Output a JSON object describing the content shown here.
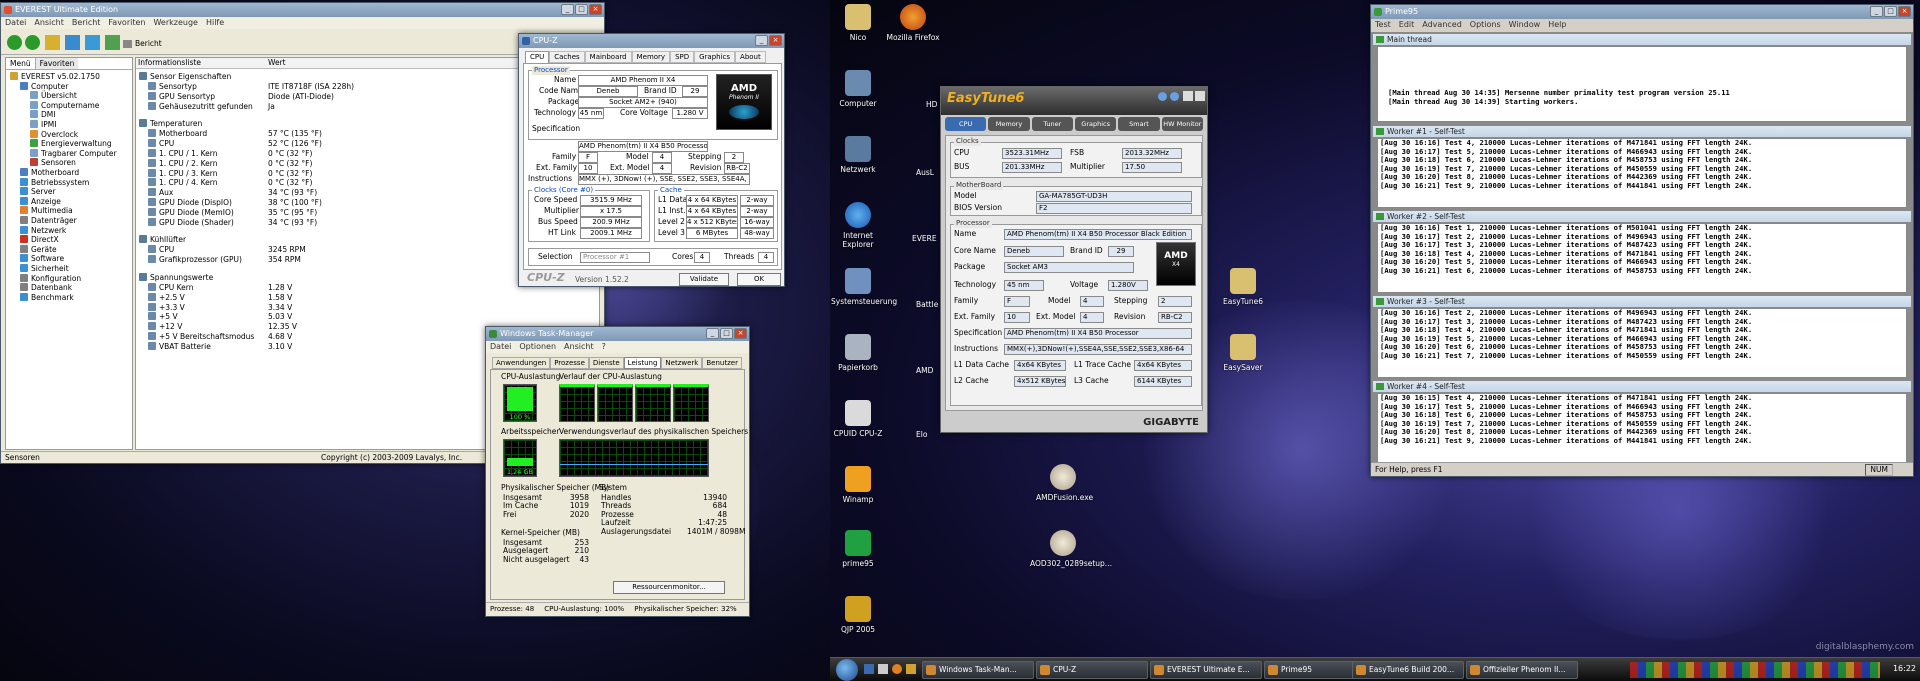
{
  "everest": {
    "title": "EVEREST Ultimate Edition",
    "menu": [
      "Datei",
      "Ansicht",
      "Bericht",
      "Favoriten",
      "Werkzeuge",
      "Hilfe"
    ],
    "report_button": "Bericht",
    "tabs": [
      "Menü",
      "Favoriten"
    ],
    "columns": {
      "info": "Informationsliste",
      "value": "Wert"
    },
    "tree": [
      "EVEREST v5.02.1750",
      "Computer",
      "Übersicht",
      "Computername",
      "DMI",
      "IPMI",
      "Overclock",
      "Energieverwaltung",
      "Tragbarer Computer",
      "Sensoren",
      "Motherboard",
      "Betriebssystem",
      "Server",
      "Anzeige",
      "Multimedia",
      "Datenträger",
      "Netzwerk",
      "DirectX",
      "Geräte",
      "Software",
      "Sicherheit",
      "Konfiguration",
      "Datenbank",
      "Benchmark"
    ],
    "sections": [
      {
        "title": "Sensor Eigenschaften",
        "rows": [
          [
            "Sensortyp",
            "ITE IT8718F (ISA 228h)"
          ],
          [
            "GPU Sensortyp",
            "Diode (ATI-Diode)"
          ],
          [
            "Gehäusezutritt gefunden",
            "Ja"
          ]
        ]
      },
      {
        "title": "Temperaturen",
        "rows": [
          [
            "Motherboard",
            "57 °C (135 °F)"
          ],
          [
            "CPU",
            "52 °C (126 °F)"
          ],
          [
            "1. CPU / 1. Kern",
            "0 °C (32 °F)"
          ],
          [
            "1. CPU / 2. Kern",
            "0 °C (32 °F)"
          ],
          [
            "1. CPU / 3. Kern",
            "0 °C (32 °F)"
          ],
          [
            "1. CPU / 4. Kern",
            "0 °C (32 °F)"
          ],
          [
            "Aux",
            "34 °C (93 °F)"
          ],
          [
            "GPU Diode (DispIO)",
            "38 °C (100 °F)"
          ],
          [
            "GPU Diode (MemIO)",
            "35 °C (95 °F)"
          ],
          [
            "GPU Diode (Shader)",
            "34 °C (93 °F)"
          ]
        ]
      },
      {
        "title": "Kühllüfter",
        "rows": [
          [
            "CPU",
            "3245 RPM"
          ],
          [
            "Grafikprozessor (GPU)",
            "354 RPM"
          ]
        ]
      },
      {
        "title": "Spannungswerte",
        "rows": [
          [
            "CPU Kern",
            "1.28 V"
          ],
          [
            "+2.5 V",
            "1.58 V"
          ],
          [
            "+3.3 V",
            "3.34 V"
          ],
          [
            "+5 V",
            "5.03 V"
          ],
          [
            "+12 V",
            "12.35 V"
          ],
          [
            "+5 V Bereitschaftsmodus",
            "4.68 V"
          ],
          [
            "VBAT Batterie",
            "3.10 V"
          ]
        ]
      }
    ],
    "status_left": "Sensoren",
    "status_right": "Copyright (c) 2003-2009 Lavalys, Inc."
  },
  "cpuz": {
    "title": "CPU-Z",
    "tabs": [
      "CPU",
      "Caches",
      "Mainboard",
      "Memory",
      "SPD",
      "Graphics",
      "About"
    ],
    "processor_label": "Processor",
    "name_label": "Name",
    "name": "AMD Phenom II X4",
    "codename_label": "Code Name",
    "codename": "Deneb",
    "brandid_label": "Brand ID",
    "brandid": "29",
    "package_label": "Package",
    "package": "Socket AM2+ (940)",
    "tech_label": "Technology",
    "tech": "45 nm",
    "cv_label": "Core Voltage",
    "cv": "1.280 V",
    "spec_label": "Specification",
    "spec": "AMD Phenom(tm) II X4 B50 Processor",
    "family_label": "Family",
    "family": "F",
    "model_label": "Model",
    "model": "4",
    "stepping_label": "Stepping",
    "stepping": "2",
    "extfam_label": "Ext. Family",
    "extfam": "10",
    "extmodel_label": "Ext. Model",
    "extmodel": "4",
    "revision_label": "Revision",
    "revision": "RB-C2",
    "instr_label": "Instructions",
    "instr": "MMX (+), 3DNow! (+), SSE, SSE2, SSE3, SSE4A, x86-64",
    "clocks_label": "Clocks (Core #0)",
    "corespeed_label": "Core Speed",
    "corespeed": "3515.9 MHz",
    "mult_label": "Multiplier",
    "mult": "x 17.5",
    "bus_label": "Bus Speed",
    "bus": "200.9 MHz",
    "ht_label": "HT Link",
    "ht": "2009.1 MHz",
    "cache_label": "Cache",
    "l1d_label": "L1 Data",
    "l1d": "4 x 64 KBytes",
    "l1d_w": "2-way",
    "l1i_label": "L1 Inst.",
    "l1i": "4 x 64 KBytes",
    "l1i_w": "2-way",
    "l2_label": "Level 2",
    "l2": "4 x 512 KBytes",
    "l2_w": "16-way",
    "l3_label": "Level 3",
    "l3": "6 MBytes",
    "l3_w": "48-way",
    "selection_label": "Selection",
    "selection": "Processor #1",
    "cores_label": "Cores",
    "cores": "4",
    "threads_label": "Threads",
    "threads": "4",
    "brand": "CPU-Z",
    "version": "Version 1.52.2",
    "validate": "Validate",
    "ok": "OK",
    "logo_top": "AMD",
    "logo_sub": "Phenom II"
  },
  "taskmgr": {
    "title": "Windows Task-Manager",
    "menu": [
      "Datei",
      "Optionen",
      "Ansicht",
      "?"
    ],
    "tabs": [
      "Anwendungen",
      "Prozesse",
      "Dienste",
      "Leistung",
      "Netzwerk",
      "Benutzer"
    ],
    "cpu_label": "CPU-Auslastung",
    "cpu_value": "100 %",
    "cpu_hist_label": "Verlauf der CPU-Auslastung",
    "mem_label": "Arbeitsspeicher",
    "mem_value": "1,24 GB",
    "mem_hist_label": "Verwendungsverlauf des physikalischen Speichers",
    "phys_title": "Physikalischer Speicher (MB)",
    "phys": [
      [
        "Insgesamt",
        "3958"
      ],
      [
        "Im Cache",
        "1019"
      ],
      [
        "Frei",
        "2020"
      ]
    ],
    "sys_title": "System",
    "sys": [
      [
        "Handles",
        "13940"
      ],
      [
        "Threads",
        "684"
      ],
      [
        "Prozesse",
        "48"
      ],
      [
        "Laufzeit",
        "1:47:25"
      ],
      [
        "Auslagerungsdatei",
        "1401M / 8098M"
      ]
    ],
    "kern_title": "Kernel-Speicher (MB)",
    "kern": [
      [
        "Insgesamt",
        "253"
      ],
      [
        "Ausgelagert",
        "210"
      ],
      [
        "Nicht ausgelagert",
        "43"
      ]
    ],
    "resmon": "Ressourcenmonitor...",
    "status": [
      "Prozesse: 48",
      "CPU-Auslastung: 100%",
      "Physikalischer Speicher: 32%"
    ],
    "cpu_load": 1.0,
    "mem_load": 0.32
  },
  "easytune": {
    "title": "EasyTune6",
    "tabs": [
      "CPU",
      "Memory",
      "Tuner",
      "Graphics",
      "Smart",
      "HW Monitor"
    ],
    "clocks_label": "Clocks",
    "cpu_label": "CPU",
    "cpu": "3523.31MHz",
    "fsb_label": "FSB",
    "fsb": "2013.32MHz",
    "bus_label": "BUS",
    "bus": "201.33MHz",
    "mult_label": "Multiplier",
    "mult": "17.50",
    "mb_label": "MotherBoard",
    "model_label": "Model",
    "model": "GA-MA785GT-UD3H",
    "bios_label": "BIOS Version",
    "bios": "F2",
    "proc_label": "Processor",
    "name_label": "Name",
    "name": "AMD Phenom(tm) II X4 B50 Processor Black Edition",
    "cn_label": "Core Name",
    "cn": "Deneb",
    "bid_label": "Brand ID",
    "bid": "29",
    "pkg_label": "Package",
    "pkg": "Socket AM3",
    "tech_label": "Technology",
    "tech": "45 nm",
    "volt_label": "Voltage",
    "volt": "1.280V",
    "fam_label": "Family",
    "fam": "F",
    "mod_label": "Model",
    "mod": "4",
    "step_label": "Stepping",
    "step": "2",
    "ef_label": "Ext. Family",
    "ef": "10",
    "em_label": "Ext. Model",
    "em": "4",
    "rev_label": "Revision",
    "rev": "RB-C2",
    "spec_label": "Specification",
    "spec": "AMD Phenom(tm) II X4 B50 Processor",
    "ins_label": "Instructions",
    "ins": "MMX(+),3DNow!(+),SSE4A,SSE,SSE2,SSE3,X86-64",
    "l1d_label": "L1 Data Cache",
    "l1d": "4x64 KBytes",
    "l1t_label": "L1 Trace Cache",
    "l1t": "4x64 KBytes",
    "l2_label": "L2 Cache",
    "l2": "4x512 KBytes",
    "l3_label": "L3 Cache",
    "l3": "6144 KBytes",
    "brand": "GIGABYTE",
    "logo": "AMD",
    "logo_sub": "X4"
  },
  "prime": {
    "title": "Prime95",
    "menu": [
      "Test",
      "Edit",
      "Advanced",
      "Options",
      "Window",
      "Help"
    ],
    "main_title": "Main thread",
    "main_lines": [
      "[Main thread Aug 30 14:35] Mersenne number primality test program version 25.11",
      "[Main thread Aug 30 14:39] Starting workers."
    ],
    "workers": [
      {
        "title": "Worker #1 - Self-Test",
        "lines": [
          "[Aug 30 16:16] Test 4, 210000 Lucas-Lehmer iterations of M471841 using FFT length 24K.",
          "[Aug 30 16:17] Test 5, 210000 Lucas-Lehmer iterations of M466943 using FFT length 24K.",
          "[Aug 30 16:18] Test 6, 210000 Lucas-Lehmer iterations of M458753 using FFT length 24K.",
          "[Aug 30 16:19] Test 7, 210000 Lucas-Lehmer iterations of M450559 using FFT length 24K.",
          "[Aug 30 16:20] Test 8, 210000 Lucas-Lehmer iterations of M442369 using FFT length 24K.",
          "[Aug 30 16:21] Test 9, 210000 Lucas-Lehmer iterations of M441841 using FFT length 24K."
        ]
      },
      {
        "title": "Worker #2 - Self-Test",
        "lines": [
          "[Aug 30 16:16] Test 1, 210000 Lucas-Lehmer iterations of M501041 using FFT length 24K.",
          "[Aug 30 16:17] Test 2, 210000 Lucas-Lehmer iterations of M496943 using FFT length 24K.",
          "[Aug 30 16:17] Test 3, 210000 Lucas-Lehmer iterations of M487423 using FFT length 24K.",
          "[Aug 30 16:18] Test 4, 210000 Lucas-Lehmer iterations of M471841 using FFT length 24K.",
          "[Aug 30 16:20] Test 5, 210000 Lucas-Lehmer iterations of M466943 using FFT length 24K.",
          "[Aug 30 16:21] Test 6, 210000 Lucas-Lehmer iterations of M458753 using FFT length 24K."
        ]
      },
      {
        "title": "Worker #3 - Self-Test",
        "lines": [
          "[Aug 30 16:16] Test 2, 210000 Lucas-Lehmer iterations of M496943 using FFT length 24K.",
          "[Aug 30 16:17] Test 3, 210000 Lucas-Lehmer iterations of M487423 using FFT length 24K.",
          "[Aug 30 16:18] Test 4, 210000 Lucas-Lehmer iterations of M471841 using FFT length 24K.",
          "[Aug 30 16:19] Test 5, 210000 Lucas-Lehmer iterations of M466943 using FFT length 24K.",
          "[Aug 30 16:20] Test 6, 210000 Lucas-Lehmer iterations of M458753 using FFT length 24K.",
          "[Aug 30 16:21] Test 7, 210000 Lucas-Lehmer iterations of M450559 using FFT length 24K."
        ]
      },
      {
        "title": "Worker #4 - Self-Test",
        "lines": [
          "[Aug 30 16:15] Test 4, 210000 Lucas-Lehmer iterations of M471841 using FFT length 24K.",
          "[Aug 30 16:17] Test 5, 210000 Lucas-Lehmer iterations of M466943 using FFT length 24K.",
          "[Aug 30 16:18] Test 6, 210000 Lucas-Lehmer iterations of M458753 using FFT length 24K.",
          "[Aug 30 16:19] Test 7, 210000 Lucas-Lehmer iterations of M450559 using FFT length 24K.",
          "[Aug 30 16:20] Test 8, 210000 Lucas-Lehmer iterations of M442369 using FFT length 24K.",
          "[Aug 30 16:21] Test 9, 210000 Lucas-Lehmer iterations of M441841 using FFT length 24K."
        ]
      }
    ],
    "status": "For Help, press F1",
    "num": "NUM"
  },
  "desktop": {
    "icons": [
      "Nico",
      "Mozilla Firefox",
      "Computer",
      "Netzwerk",
      "Internet Explorer",
      "Systemsteuerung",
      "Papierkorb",
      "CPUID CPU-Z",
      "Winamp",
      "prime95",
      "QJP 2005",
      "AMDFusion.exe",
      "AOD302_0289setup...",
      "EasyTune6",
      "EasySaver"
    ],
    "partial_icons": [
      "HD",
      "AusL",
      "EVERE",
      "Battle Verk",
      "AMD",
      "Elo"
    ]
  },
  "taskbar": {
    "items": [
      "Windows Task-Man...",
      "CPU-Z",
      "EVEREST Ultimate E...",
      "Prime95",
      "EasyTune6 Build 200...",
      "Offizieller Phenom II..."
    ],
    "clock": "16:22"
  },
  "watermark": "digitalblasphemy.com"
}
